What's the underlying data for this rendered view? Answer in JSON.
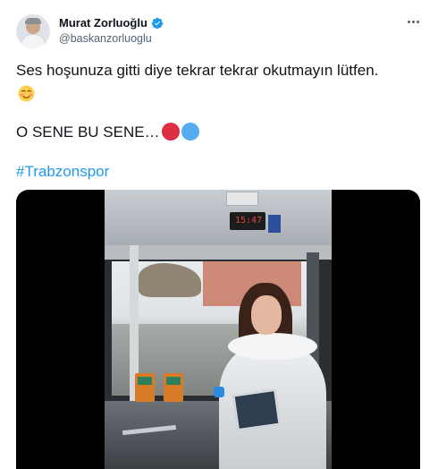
{
  "user": {
    "display_name": "Murat Zorluoğlu",
    "handle": "@baskanzorluoglu",
    "verified": true,
    "avatar_icon": "profile-avatar"
  },
  "menu": {
    "icon": "more-horizontal-icon"
  },
  "tweet": {
    "line1": "Ses hoşunuza gitti diye tekrar tekrar okutmayın lütfen.",
    "emoji1": "smiling-face-with-blush-icon",
    "line2": "O SENE BU SENE…",
    "dots": [
      {
        "icon": "red-circle-icon",
        "color": "#dd2e44"
      },
      {
        "icon": "blue-circle-icon",
        "color": "#55acee"
      }
    ],
    "hashtag": "#Trabzonspor"
  },
  "media": {
    "type": "video",
    "bus_display_text": "15:47"
  },
  "colors": {
    "accent": "#1d9bf0",
    "text": "#0f1419",
    "secondary": "#536471"
  }
}
